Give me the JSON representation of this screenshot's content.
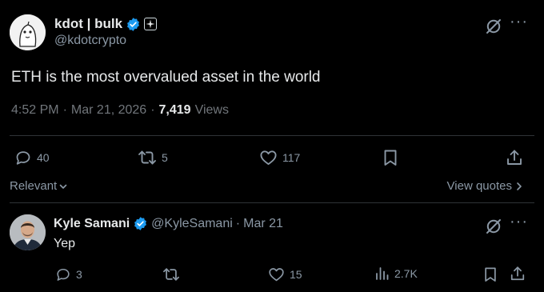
{
  "tweet": {
    "display_name": "kdot | bulk",
    "handle": "@kdotcrypto",
    "text": "ETH is the most overvalued asset in the world",
    "time": "4:52 PM",
    "dot1": "·",
    "date": "Mar 21, 2026",
    "dot2": "·",
    "views_count": "7,419",
    "views_label": "Views",
    "replies": "40",
    "reposts": "5",
    "likes": "117"
  },
  "filters": {
    "sort_label": "Relevant",
    "view_quotes_label": "View quotes"
  },
  "reply": {
    "display_name": "Kyle Samani",
    "handle": "@KyleSamani",
    "dot": "·",
    "date": "Mar 21",
    "text": "Yep",
    "replies": "3",
    "likes": "15",
    "views": "2.7K"
  },
  "colors": {
    "background": "#000000",
    "text_primary": "#e7e9ea",
    "text_secondary": "#8b98a5",
    "verified_blue": "#1d9bf0",
    "divider": "#2f3336"
  },
  "icons": [
    "verified-badge-icon",
    "affiliate-badge-icon",
    "grok-icon",
    "more-icon",
    "reply-icon",
    "repost-icon",
    "like-icon",
    "bookmark-icon",
    "share-icon",
    "views-icon",
    "chevron-down-icon",
    "chevron-right-icon"
  ]
}
